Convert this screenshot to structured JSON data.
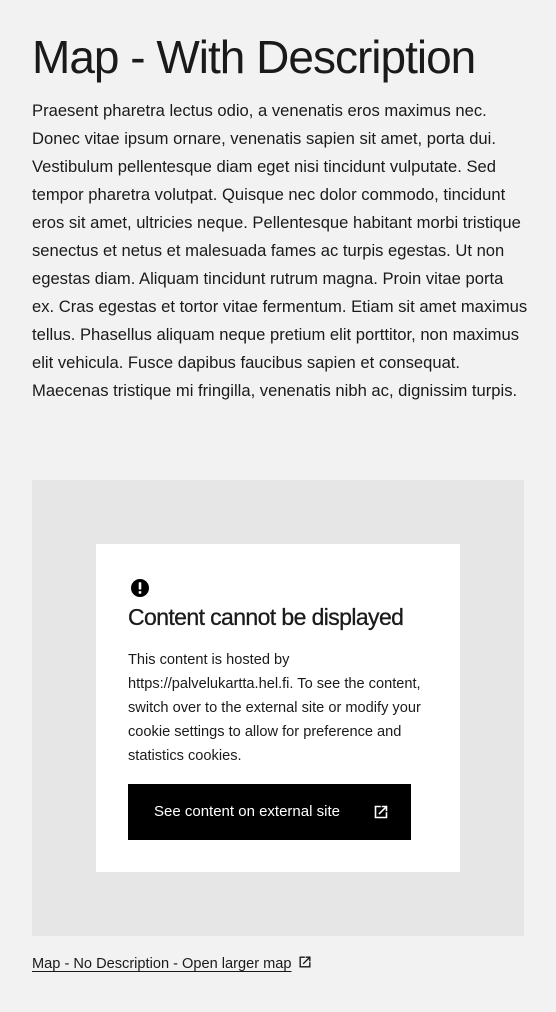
{
  "page": {
    "title": "Map - With Description",
    "description": "Praesent pharetra lectus odio, a venenatis eros maximus nec. Donec vitae ipsum ornare, venenatis sapien sit amet, porta dui. Vestibulum pellentesque diam eget nisi tincidunt vulputate. Sed tempor pharetra volutpat. Quisque nec dolor commodo, tincidunt eros sit amet, ultricies neque. Pellentesque habitant morbi tristique senectus et netus et malesuada fames ac turpis egestas. Ut non egestas diam. Aliquam tincidunt rutrum magna. Proin vitae porta ex. Cras egestas et tortor vitae fermentum. Etiam sit amet maximus tellus. Phasellus aliquam neque pretium elit porttitor, non maximus elit vehicula. Fusce dapibus faucibus sapien et consequat. Maecenas tristique mi fringilla, venenatis nibh ac, dignissim turpis."
  },
  "map": {
    "notice": {
      "icon": "alert-circle-icon",
      "title": "Content cannot be displayed",
      "text": "This content is hosted by https://palvelukartta.hel.fi. To see the content, switch over to the external site or modify your cookie settings to allow for preference and statistics cookies.",
      "button_label": "See content on external site",
      "button_icon": "external-link-icon"
    }
  },
  "link": {
    "label": "Map - No Description - Open larger map",
    "icon": "external-link-icon"
  },
  "colors": {
    "background": "#f2f2f2",
    "map_placeholder": "#e6e6e6",
    "card": "#ffffff",
    "button": "#000000",
    "text": "#1a1a1a"
  }
}
